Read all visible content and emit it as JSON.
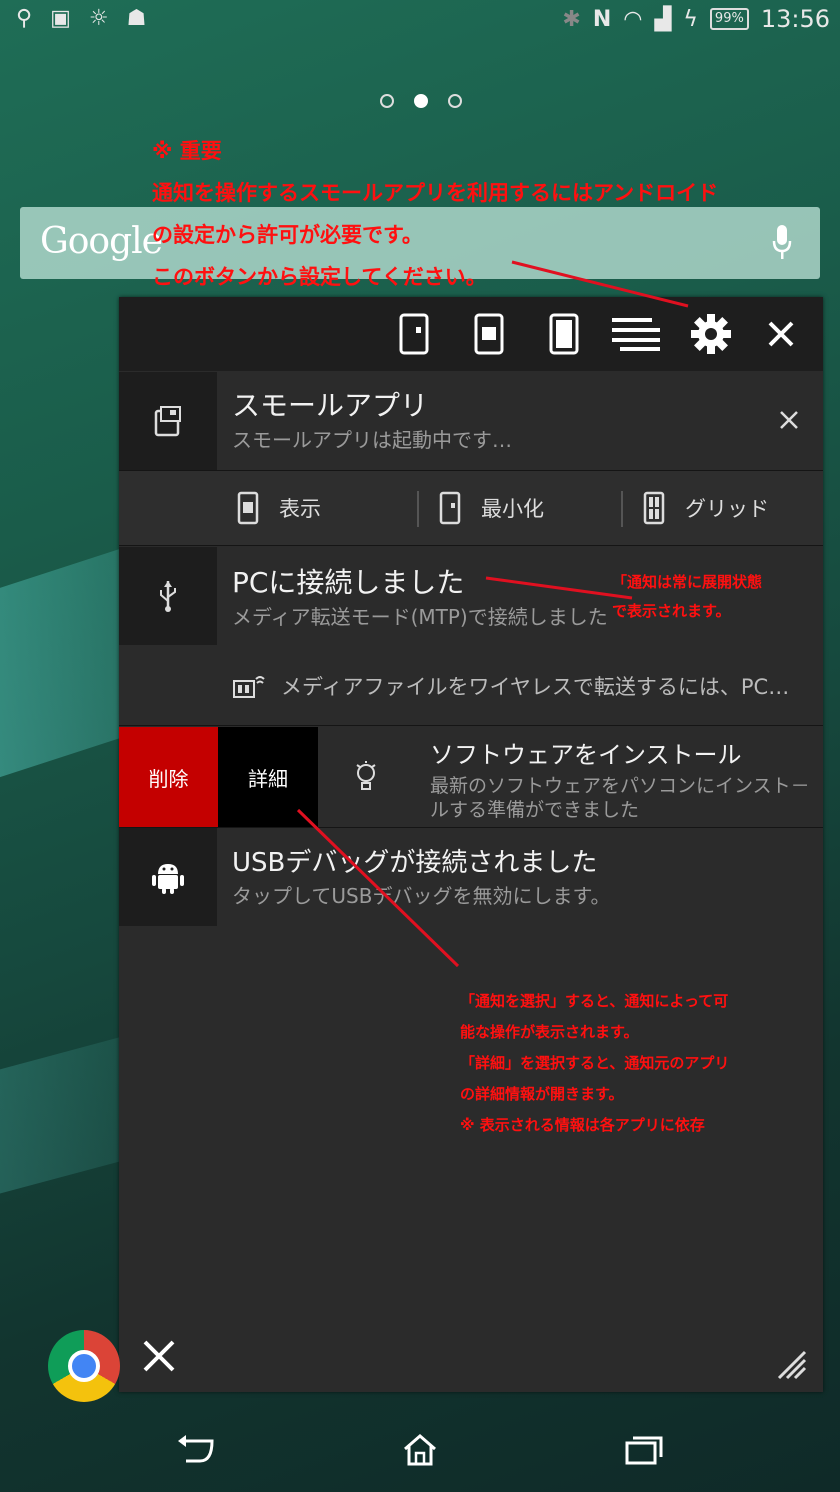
{
  "status_bar": {
    "battery": "99%",
    "time": "13:56"
  },
  "home": {
    "google_logo": "Google"
  },
  "annotations": {
    "top": [
      "※ 重要",
      "通知を操作するスモールアプリを利用するにはアンドロイド",
      "の設定から許可が必要です。",
      "このボタンから設定してください。"
    ],
    "middle": [
      "「通知は常に展開状態",
      "で表示されます。"
    ],
    "bottom": [
      "「通知を選択」すると、通知によって可",
      "能な操作が表示されます。",
      "「詳細」を選択すると、通知元のアプリ",
      "の詳細情報が開きます。",
      "※ 表示される情報は各アプリに依存"
    ]
  },
  "notifications": {
    "small_app": {
      "title": "スモールアプリ",
      "subtitle": "スモールアプリは起動中です…",
      "actions": [
        "表示",
        "最小化",
        "グリッド"
      ]
    },
    "pc": {
      "title": "PCに接続しました",
      "subtitle": "メディア転送モード(MTP)で接続しました",
      "detail": "メディアファイルをワイヤレスで転送するには、PC…"
    },
    "software": {
      "delete_label": "削除",
      "detail_label": "詳細",
      "title": "ソフトウェアをインストール",
      "subtitle_line1": "最新のソフトウェアをパソコンにインスト－",
      "subtitle_line2": "ルする準備ができました"
    },
    "usb": {
      "title": "USBデバッグが接続されました",
      "subtitle": "タップしてUSBデバッグを無効にします。"
    }
  },
  "colors": {
    "panel": "#2b2b2b",
    "delete": "#c40000",
    "annotation": "#ff1010"
  }
}
